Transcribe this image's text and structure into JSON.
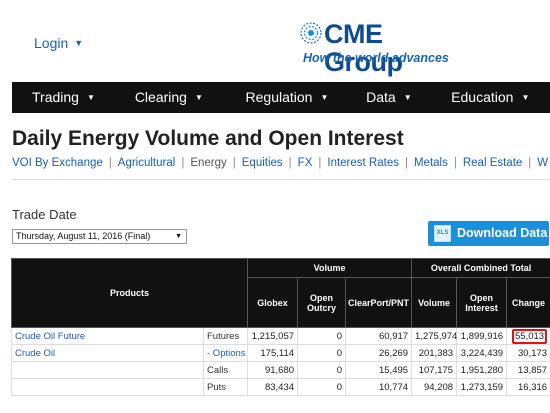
{
  "header": {
    "login_label": "Login",
    "logo_text": "CME Group",
    "tagline": "How the world advances"
  },
  "nav": {
    "items": [
      {
        "label": "Trading"
      },
      {
        "label": "Clearing"
      },
      {
        "label": "Regulation"
      },
      {
        "label": "Data"
      },
      {
        "label": "Education"
      }
    ]
  },
  "page": {
    "title": "Daily Energy Volume and Open Interest"
  },
  "subnav": {
    "items": [
      {
        "label": "VOI By Exchange"
      },
      {
        "label": "Agricultural"
      },
      {
        "label": "Energy"
      },
      {
        "label": "Equities"
      },
      {
        "label": "FX"
      },
      {
        "label": "Interest Rates"
      },
      {
        "label": "Metals"
      },
      {
        "label": "Real Estate"
      },
      {
        "label": "W"
      }
    ],
    "active": "Energy"
  },
  "trade_date": {
    "label": "Trade Date",
    "selected": "Thursday, August 11, 2016 (Final)"
  },
  "download": {
    "icon_text": "XLS",
    "label": "Download Data"
  },
  "table": {
    "group_headers": {
      "products": "Products",
      "volume": "Volume",
      "overall": "Overall Combined Total"
    },
    "columns": {
      "globex": "Globex",
      "open_outcry": "Open Outcry",
      "clearport": "ClearPort/PNT",
      "volume": "Volume",
      "open_interest": "Open Interest",
      "change": "Change"
    },
    "rows": [
      {
        "product": "Crude Oil Future",
        "type": "Futures",
        "globex": "1,215,057",
        "open_outcry": "0",
        "clearport": "60,917",
        "volume": "1,275,974",
        "open_interest": "1,899,916",
        "change": "55,013"
      },
      {
        "product": "Crude Oil",
        "type": "- Options",
        "globex": "175,114",
        "open_outcry": "0",
        "clearport": "26,269",
        "volume": "201,383",
        "open_interest": "3,224,439",
        "change": "30,173"
      },
      {
        "product": "",
        "type": "Calls",
        "globex": "91,680",
        "open_outcry": "0",
        "clearport": "15,495",
        "volume": "107,175",
        "open_interest": "1,951,280",
        "change": "13,857"
      },
      {
        "product": "",
        "type": "Puts",
        "globex": "83,434",
        "open_outcry": "0",
        "clearport": "10,774",
        "volume": "94,208",
        "open_interest": "1,273,159",
        "change": "16,316"
      }
    ]
  }
}
